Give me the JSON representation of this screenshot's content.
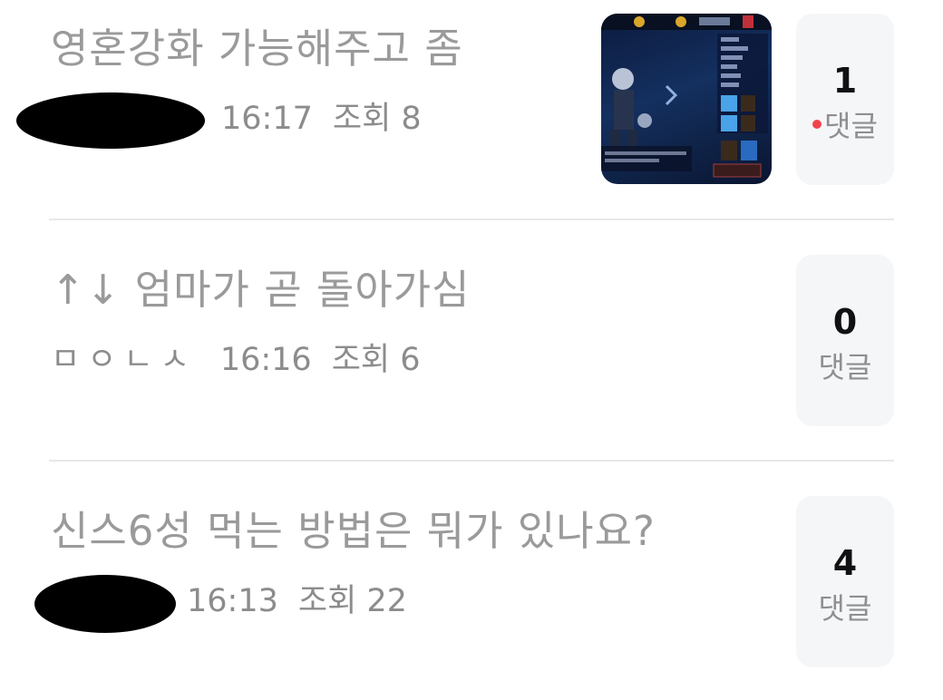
{
  "posts": [
    {
      "title": "영혼강화 가능해주고 좀",
      "author": "",
      "time": "16:17",
      "views": "조회 8",
      "comment_count": "1",
      "comment_label": "댓글",
      "has_new_comment": true,
      "has_thumbnail": true,
      "author_redacted": true
    },
    {
      "title": "↑↓ 엄마가 곧 돌아가심",
      "author": "ㅁㅇㄴㅅ",
      "time": "16:16",
      "views": "조회 6",
      "comment_count": "0",
      "comment_label": "댓글",
      "has_new_comment": false,
      "has_thumbnail": false,
      "author_redacted": false
    },
    {
      "title": "신스6성 먹는 방법은 뭐가 있나요?",
      "author": "",
      "time": "16:13",
      "views": "조회 22",
      "comment_count": "4",
      "comment_label": "댓글",
      "has_new_comment": false,
      "has_thumbnail": false,
      "author_redacted": true
    }
  ],
  "colors": {
    "title": "#9a9a9a",
    "meta": "#8c8c8c",
    "comment_box_bg": "#f5f6f8",
    "new_dot": "#f0434d",
    "divider": "#e8e8e8"
  }
}
